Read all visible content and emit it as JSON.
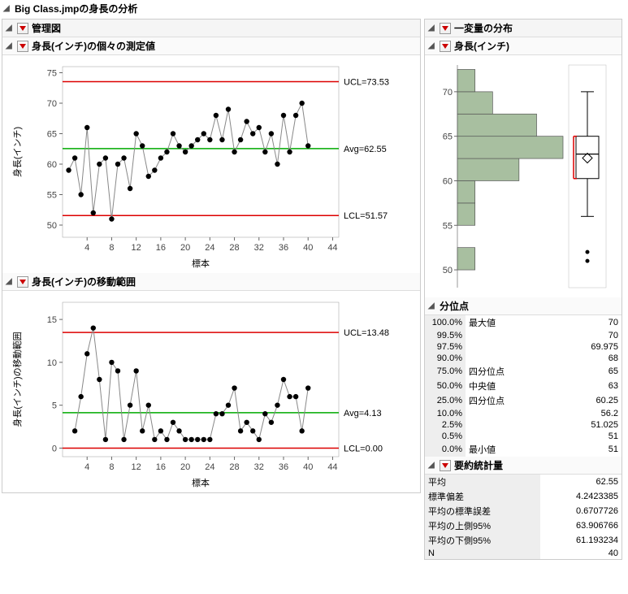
{
  "title": "Big Class.jmpの身長の分析",
  "left": {
    "panel_title": "管理図",
    "chart1": {
      "title": "身長(インチ)の個々の測定値",
      "ylabel": "身長(インチ)",
      "xlabel": "標本",
      "ucl_label": "UCL=73.53",
      "avg_label": "Avg=62.55",
      "lcl_label": "LCL=51.57"
    },
    "chart2": {
      "title": "身長(インチ)の移動範囲",
      "ylabel": "身長(インチ)の移動範囲",
      "xlabel": "標本",
      "ucl_label": "UCL=13.48",
      "avg_label": "Avg=4.13",
      "lcl_label": "LCL=0.00"
    }
  },
  "right": {
    "panel_title": "一変量の分布",
    "subpanel_title": "身長(インチ)",
    "quantiles_title": "分位点",
    "quantiles": [
      {
        "pct": "100.0%",
        "label": "最大値",
        "value": "70"
      },
      {
        "pct": "99.5%",
        "label": "",
        "value": "70"
      },
      {
        "pct": "97.5%",
        "label": "",
        "value": "69.975"
      },
      {
        "pct": "90.0%",
        "label": "",
        "value": "68"
      },
      {
        "pct": "75.0%",
        "label": "四分位点",
        "value": "65"
      },
      {
        "pct": "50.0%",
        "label": "中央値",
        "value": "63"
      },
      {
        "pct": "25.0%",
        "label": "四分位点",
        "value": "60.25"
      },
      {
        "pct": "10.0%",
        "label": "",
        "value": "56.2"
      },
      {
        "pct": "2.5%",
        "label": "",
        "value": "51.025"
      },
      {
        "pct": "0.5%",
        "label": "",
        "value": "51"
      },
      {
        "pct": "0.0%",
        "label": "最小値",
        "value": "51"
      }
    ],
    "summary_title": "要約統計量",
    "summary": [
      {
        "label": "平均",
        "value": "62.55"
      },
      {
        "label": "標準偏差",
        "value": "4.2423385"
      },
      {
        "label": "平均の標準誤差",
        "value": "0.6707726"
      },
      {
        "label": "平均の上側95%",
        "value": "63.906766"
      },
      {
        "label": "平均の下側95%",
        "value": "61.193234"
      },
      {
        "label": "N",
        "value": "40"
      }
    ]
  },
  "chart_data": [
    {
      "type": "line",
      "name": "individual_measurements",
      "x": [
        1,
        2,
        3,
        4,
        5,
        6,
        7,
        8,
        9,
        10,
        11,
        12,
        13,
        14,
        15,
        16,
        17,
        18,
        19,
        20,
        21,
        22,
        23,
        24,
        25,
        26,
        27,
        28,
        29,
        30,
        31,
        32,
        33,
        34,
        35,
        36,
        37,
        38,
        39,
        40
      ],
      "y": [
        59,
        61,
        55,
        66,
        52,
        60,
        61,
        51,
        60,
        61,
        56,
        65,
        63,
        58,
        59,
        61,
        62,
        65,
        63,
        62,
        63,
        64,
        65,
        64,
        68,
        64,
        69,
        62,
        64,
        67,
        65,
        66,
        62,
        65,
        60,
        68,
        62,
        68,
        70,
        63
      ],
      "lines": {
        "UCL": 73.53,
        "Avg": 62.55,
        "LCL": 51.57
      },
      "ylim": [
        48,
        76
      ],
      "xlim": [
        0,
        45
      ],
      "yticks": [
        50,
        55,
        60,
        65,
        70,
        75
      ],
      "xticks": [
        4,
        8,
        12,
        16,
        20,
        24,
        28,
        32,
        36,
        40,
        44
      ],
      "xlabel": "標本",
      "ylabel": "身長(インチ)"
    },
    {
      "type": "line",
      "name": "moving_range",
      "x": [
        2,
        3,
        4,
        5,
        6,
        7,
        8,
        9,
        10,
        11,
        12,
        13,
        14,
        15,
        16,
        17,
        18,
        19,
        20,
        21,
        22,
        23,
        24,
        25,
        26,
        27,
        28,
        29,
        30,
        31,
        32,
        33,
        34,
        35,
        36,
        37,
        38,
        39,
        40
      ],
      "y": [
        2,
        6,
        11,
        14,
        8,
        1,
        10,
        9,
        1,
        5,
        9,
        2,
        5,
        1,
        2,
        1,
        3,
        2,
        1,
        1,
        1,
        1,
        1,
        4,
        4,
        5,
        7,
        2,
        3,
        2,
        1,
        4,
        3,
        5,
        8,
        6,
        6,
        2,
        7
      ],
      "lines": {
        "UCL": 13.48,
        "Avg": 4.13,
        "LCL": 0.0
      },
      "ylim": [
        -1,
        17
      ],
      "xlim": [
        0,
        45
      ],
      "yticks": [
        0,
        5,
        10,
        15
      ],
      "xticks": [
        4,
        8,
        12,
        16,
        20,
        24,
        28,
        32,
        36,
        40,
        44
      ],
      "xlabel": "標本",
      "ylabel": "身長(インチ)の移動範囲"
    },
    {
      "type": "bar",
      "name": "histogram",
      "orientation": "horizontal",
      "bin_edges": [
        50,
        52.5,
        55,
        57.5,
        60,
        62.5,
        65,
        67.5,
        70,
        72.5
      ],
      "counts": [
        2,
        0,
        2,
        2,
        7,
        12,
        9,
        4,
        2
      ],
      "ylim": [
        48,
        73
      ],
      "yticks": [
        50,
        55,
        60,
        65,
        70
      ]
    },
    {
      "type": "boxplot",
      "name": "boxplot",
      "min": 51,
      "q1": 60.25,
      "median": 63,
      "q3": 65,
      "max": 70,
      "mean": 62.55,
      "outliers": [
        51,
        52
      ]
    }
  ]
}
